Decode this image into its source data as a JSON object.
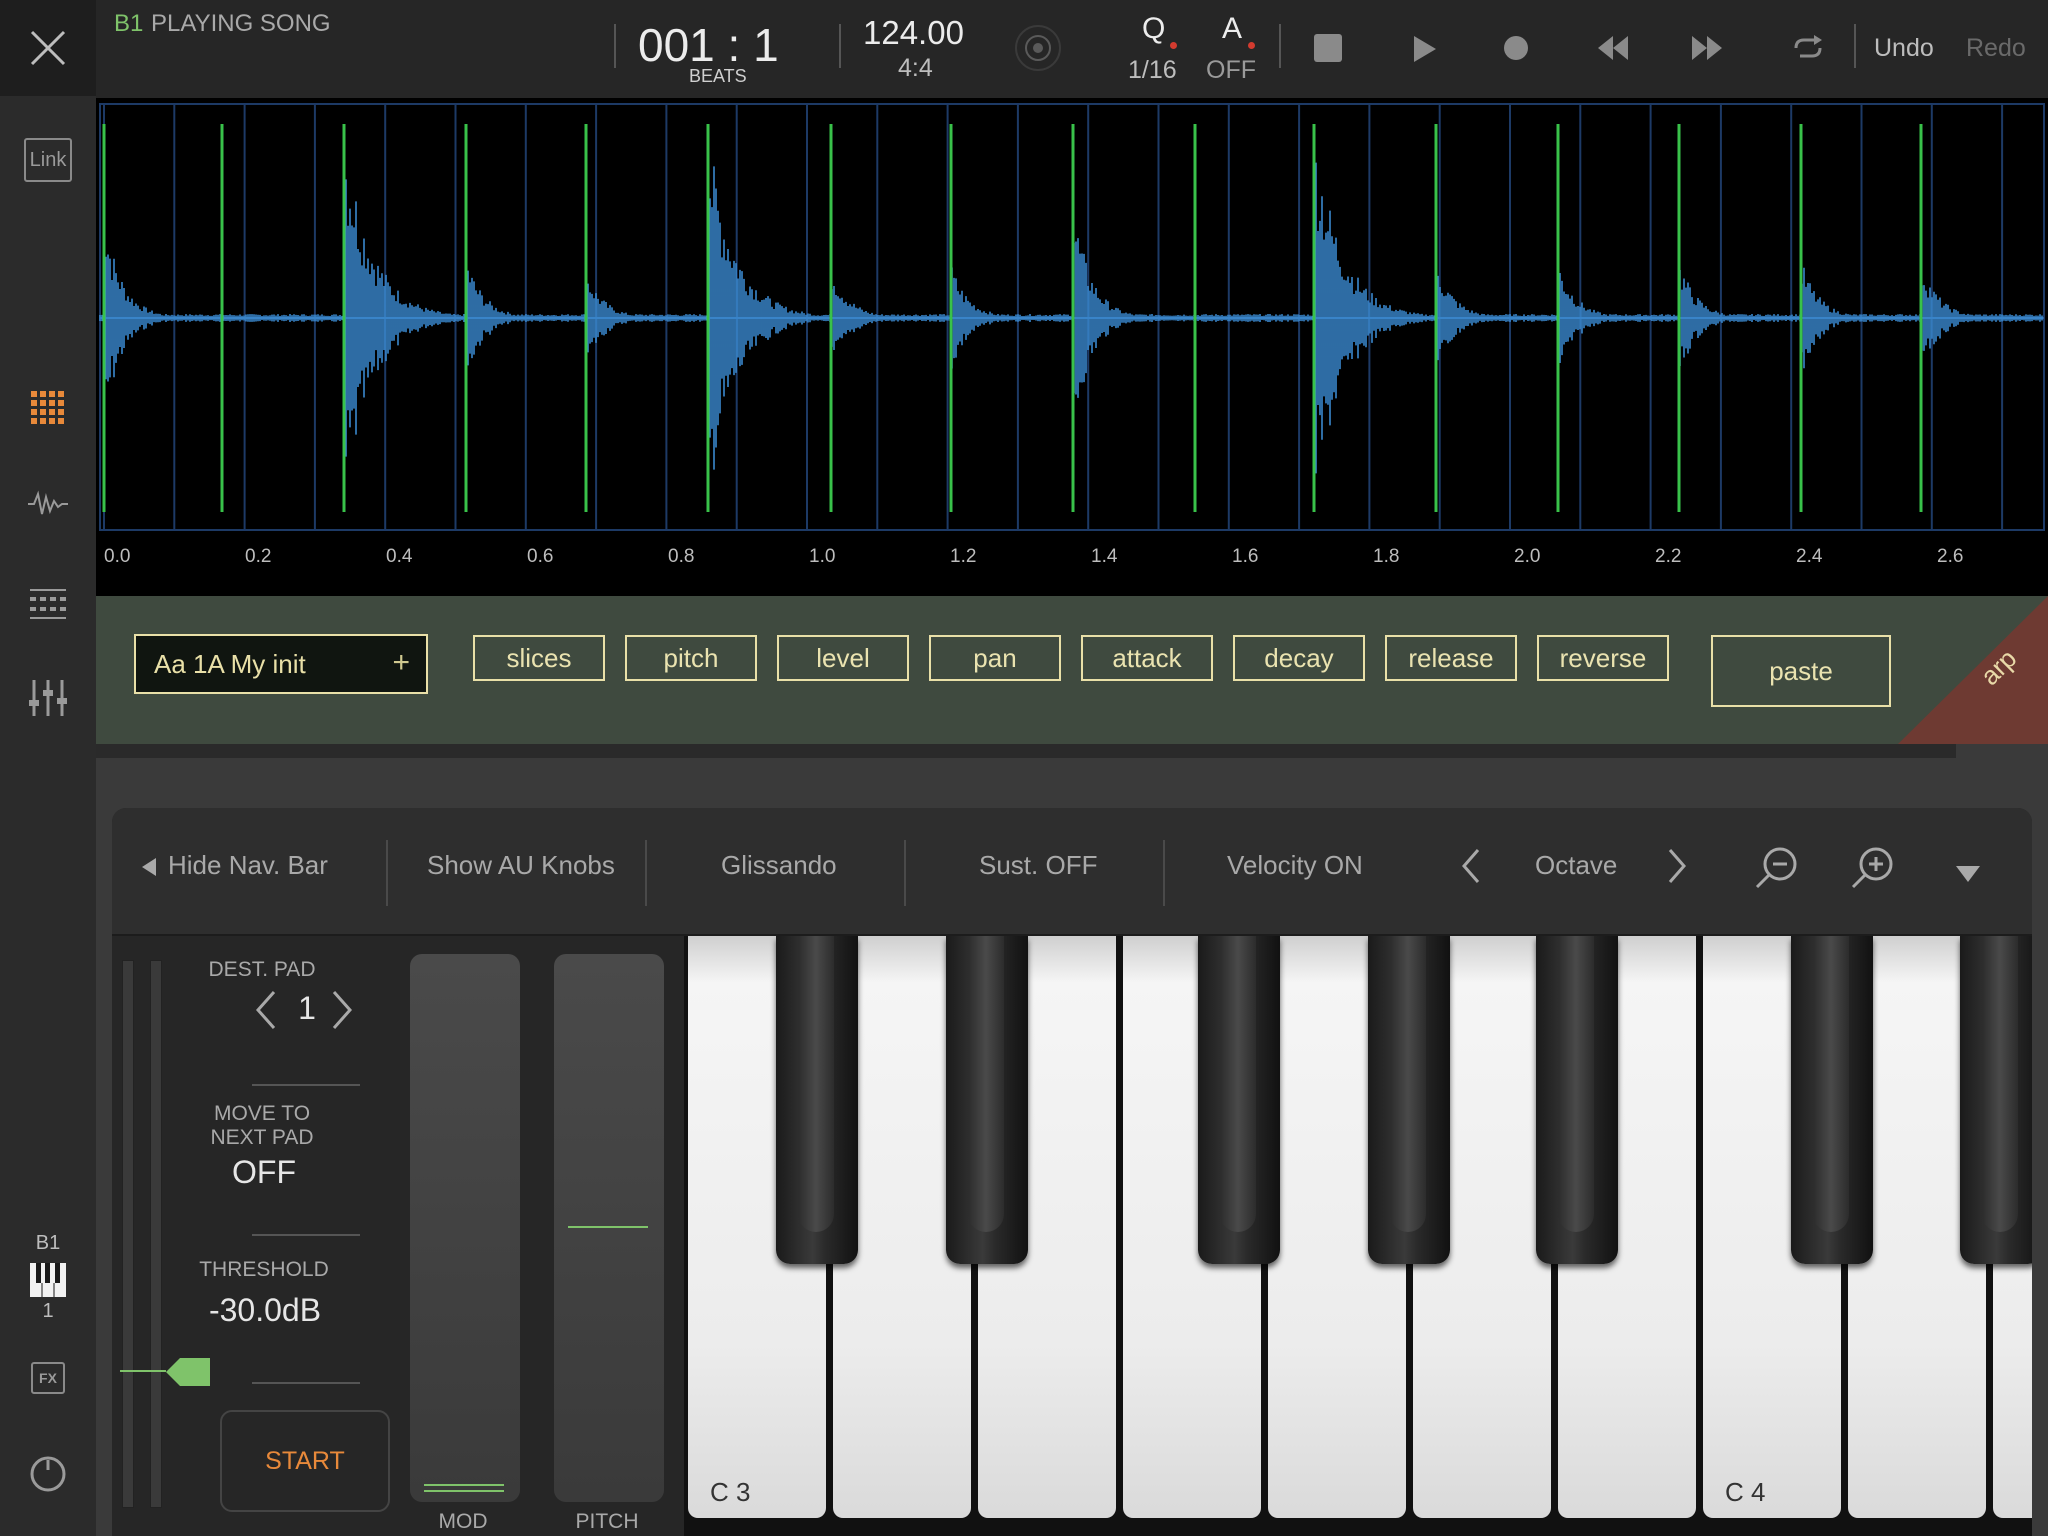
{
  "topbar": {
    "track_id": "B1",
    "status": "PLAYING SONG",
    "position": "001 : 1",
    "position_unit": "BEATS",
    "tempo": "124.00",
    "time_signature": "4:4",
    "quantize_letter": "Q",
    "quantize_value": "1/16",
    "auto_letter": "A",
    "auto_value": "OFF",
    "undo_label": "Undo",
    "redo_label": "Redo",
    "colors": {
      "track_id": "#7fc36a",
      "record_dot": "#d33b2f"
    }
  },
  "sidebar": {
    "link_label": "Link",
    "track_label": "B1",
    "track_number": "1",
    "fx_label": "FX",
    "colors": {
      "active_icon": "#e8893a"
    }
  },
  "waveform": {
    "axis_ticks": [
      "0.0",
      "0.2",
      "0.4",
      "0.6",
      "0.8",
      "1.0",
      "1.2",
      "1.4",
      "1.6",
      "1.8",
      "2.0",
      "2.2",
      "2.4",
      "2.6"
    ],
    "colors": {
      "wave": "#3d8fd8",
      "slice_marker": "#39c24a",
      "grid": "#1d3a66"
    }
  },
  "slice_bar": {
    "preset_name": "Aa 1A My init",
    "preset_add": "+",
    "buttons": [
      "slices",
      "pitch",
      "level",
      "pan",
      "attack",
      "decay",
      "release",
      "reverse"
    ],
    "paste_label": "paste",
    "arp_label": "arp",
    "colors": {
      "accent": "#e9e0a8",
      "arp": "#6e3a32"
    }
  },
  "navbar": {
    "hide_nav": "Hide Nav. Bar",
    "show_knobs": "Show AU Knobs",
    "glissando": "Glissando",
    "sustain": "Sust. OFF",
    "velocity": "Velocity ON",
    "octave": "Octave"
  },
  "controls": {
    "dest_pad_label": "DEST. PAD",
    "dest_pad_value": "1",
    "move_next_label_1": "MOVE TO",
    "move_next_label_2": "NEXT PAD",
    "move_next_value": "OFF",
    "threshold_label": "THRESHOLD",
    "threshold_value": "-30.0dB",
    "start_label": "START",
    "mod_label": "MOD",
    "pitch_label": "PITCH",
    "colors": {
      "start": "#e8893a",
      "marker": "#7fc36a"
    }
  },
  "keyboard": {
    "labels": [
      "C 3",
      "C 4"
    ]
  }
}
